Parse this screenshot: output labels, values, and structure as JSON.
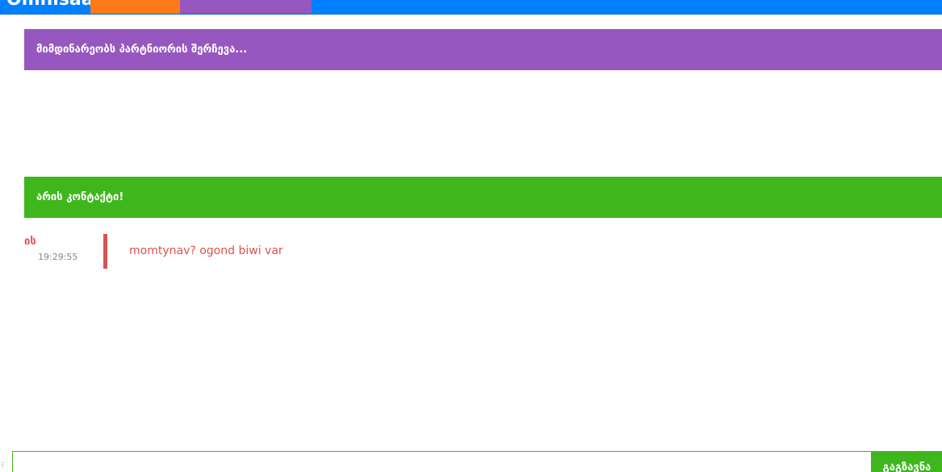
{
  "header": {
    "logo_text": "Omnisaa"
  },
  "status": {
    "searching": "მიმდინარეობს პარტნიორის შერჩევა...",
    "connected": "არის კონტაქტი!"
  },
  "messages": [
    {
      "author": "ის",
      "time": "19:29:55",
      "text": "momtynav? ogond biwi var"
    }
  ],
  "composer": {
    "value": "",
    "placeholder": "",
    "send_label": "გაგზავნა"
  },
  "colors": {
    "topbar": "#0080ff",
    "tab_orange": "#ff7a1a",
    "purple": "#9757c0",
    "green": "#3fb71c",
    "stranger": "#d9534f"
  }
}
